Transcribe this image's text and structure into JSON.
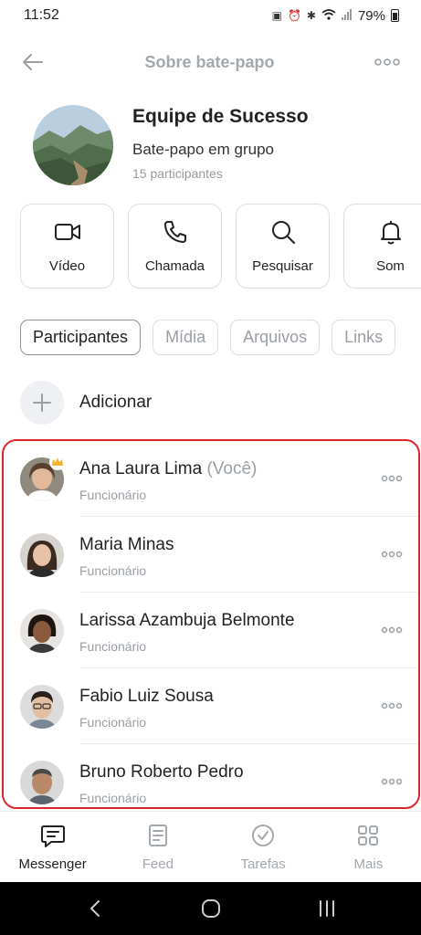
{
  "status": {
    "time": "11:52",
    "battery": "79%"
  },
  "header": {
    "title": "Sobre bate-papo"
  },
  "group": {
    "name": "Equipe de Sucesso",
    "type": "Bate-papo em grupo",
    "count": "15 participantes"
  },
  "actions": [
    {
      "label": "Vídeo",
      "icon": "video-icon"
    },
    {
      "label": "Chamada",
      "icon": "phone-icon"
    },
    {
      "label": "Pesquisar",
      "icon": "search-icon"
    },
    {
      "label": "Som",
      "icon": "bell-icon"
    }
  ],
  "tabs": [
    {
      "label": "Participantes",
      "active": true
    },
    {
      "label": "Mídia"
    },
    {
      "label": "Arquivos"
    },
    {
      "label": "Links"
    }
  ],
  "add": {
    "label": "Adicionar"
  },
  "participants": [
    {
      "name": "Ana Laura Lima",
      "suffix": "(Você)",
      "role": "Funcionário"
    },
    {
      "name": "Maria Minas",
      "role": "Funcionário"
    },
    {
      "name": "Larissa Azambuja Belmonte",
      "role": "Funcionário"
    },
    {
      "name": "Fabio Luiz Sousa",
      "role": "Funcionário"
    },
    {
      "name": "Bruno Roberto Pedro",
      "role": "Funcionário"
    }
  ],
  "bottom_nav": [
    {
      "label": "Messenger",
      "icon": "chat-icon",
      "active": true
    },
    {
      "label": "Feed",
      "icon": "feed-icon"
    },
    {
      "label": "Tarefas",
      "icon": "check-circle-icon"
    },
    {
      "label": "Mais",
      "icon": "grid-icon"
    }
  ],
  "colors": {
    "highlight_border": "#d9262c",
    "muted": "#9a9fa4",
    "text": "#222222"
  }
}
